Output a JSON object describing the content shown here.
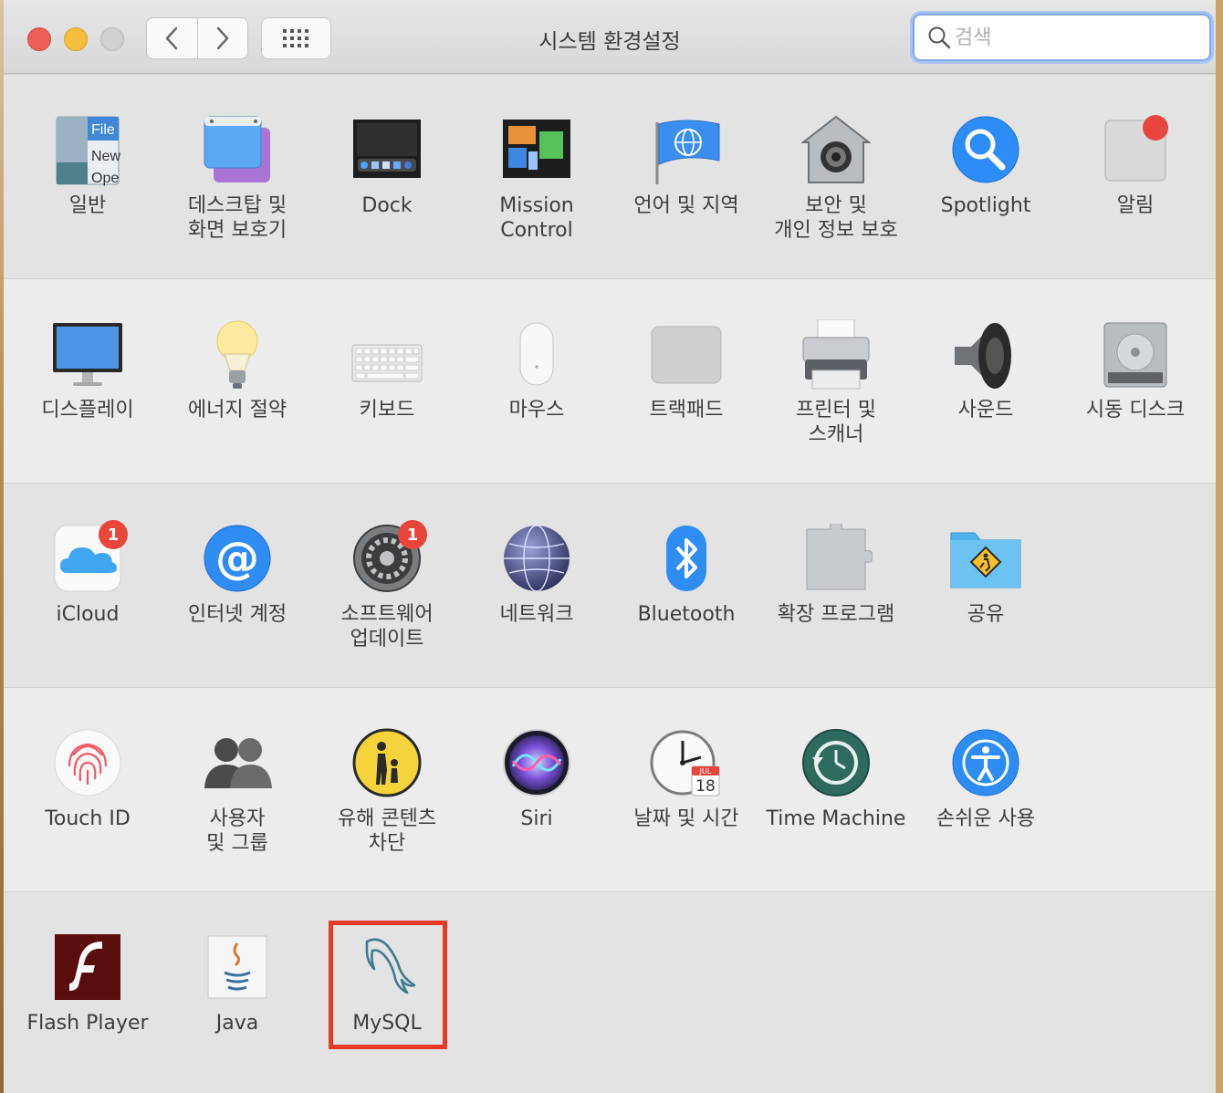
{
  "window": {
    "title": "시스템 환경설정"
  },
  "search": {
    "placeholder": "검색"
  },
  "rows": [
    {
      "items": [
        {
          "label": "일반",
          "icon": "general-icon"
        },
        {
          "label": "데스크탑 및\n화면 보호기",
          "icon": "desktop-screensaver-icon"
        },
        {
          "label": "Dock",
          "icon": "dock-icon"
        },
        {
          "label": "Mission\nControl",
          "icon": "mission-control-icon"
        },
        {
          "label": "언어 및 지역",
          "icon": "language-region-icon"
        },
        {
          "label": "보안 및\n개인 정보 보호",
          "icon": "security-privacy-icon"
        },
        {
          "label": "Spotlight",
          "icon": "spotlight-icon"
        },
        {
          "label": "알림",
          "icon": "notifications-icon"
        }
      ]
    },
    {
      "items": [
        {
          "label": "디스플레이",
          "icon": "display-icon"
        },
        {
          "label": "에너지 절약",
          "icon": "energy-saver-icon"
        },
        {
          "label": "키보드",
          "icon": "keyboard-icon"
        },
        {
          "label": "마우스",
          "icon": "mouse-icon"
        },
        {
          "label": "트랙패드",
          "icon": "trackpad-icon"
        },
        {
          "label": "프린터 및\n스캐너",
          "icon": "printers-scanners-icon"
        },
        {
          "label": "사운드",
          "icon": "sound-icon"
        },
        {
          "label": "시동 디스크",
          "icon": "startup-disk-icon"
        }
      ]
    },
    {
      "items": [
        {
          "label": "iCloud",
          "icon": "icloud-icon",
          "badge": "1"
        },
        {
          "label": "인터넷 계정",
          "icon": "internet-accounts-icon"
        },
        {
          "label": "소프트웨어\n업데이트",
          "icon": "software-update-icon",
          "badge": "1"
        },
        {
          "label": "네트워크",
          "icon": "network-icon"
        },
        {
          "label": "Bluetooth",
          "icon": "bluetooth-icon"
        },
        {
          "label": "확장 프로그램",
          "icon": "extensions-icon"
        },
        {
          "label": "공유",
          "icon": "sharing-icon"
        }
      ]
    },
    {
      "items": [
        {
          "label": "Touch ID",
          "icon": "touch-id-icon"
        },
        {
          "label": "사용자\n및 그룹",
          "icon": "users-groups-icon"
        },
        {
          "label": "유해 콘텐츠\n차단",
          "icon": "parental-controls-icon"
        },
        {
          "label": "Siri",
          "icon": "siri-icon"
        },
        {
          "label": "날짜 및 시간",
          "icon": "date-time-icon",
          "cal_month": "JUL",
          "cal_day": "18"
        },
        {
          "label": "Time Machine",
          "icon": "time-machine-icon"
        },
        {
          "label": "손쉬운 사용",
          "icon": "accessibility-icon"
        }
      ]
    },
    {
      "items": [
        {
          "label": "Flash Player",
          "icon": "flash-player-icon"
        },
        {
          "label": "Java",
          "icon": "java-icon"
        },
        {
          "label": "MySQL",
          "icon": "mysql-icon"
        }
      ]
    }
  ],
  "general_icon_text": [
    "File",
    "New",
    "Ope"
  ],
  "colors": {
    "highlight": "#e53c26",
    "badge": "#e8453c",
    "accent": "#3b82f6"
  }
}
